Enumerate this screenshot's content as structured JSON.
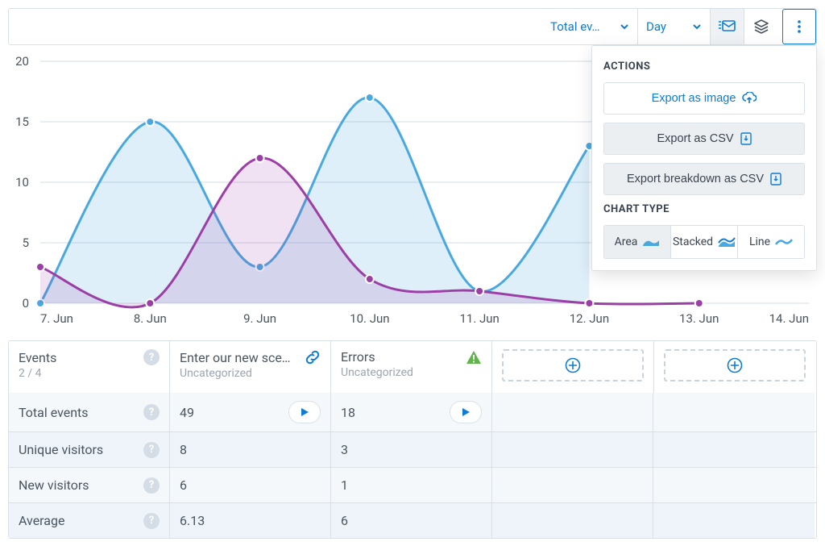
{
  "toolbar": {
    "metric_label": "Total ev…",
    "granularity_label": "Day"
  },
  "chart_data": {
    "type": "area",
    "categories": [
      "7. Jun",
      "8. Jun",
      "9. Jun",
      "10. Jun",
      "11. Jun",
      "12. Jun",
      "13. Jun",
      "14. Jun"
    ],
    "series": [
      {
        "name": "Enter our new scenario",
        "color": "#4aa8e0",
        "values": [
          0,
          15,
          3,
          17,
          1,
          13,
          null,
          null
        ]
      },
      {
        "name": "Errors",
        "color": "#9b3fa6",
        "values": [
          3,
          0,
          12,
          2,
          1,
          0,
          0,
          null
        ]
      }
    ],
    "ylim": [
      0,
      20
    ],
    "yticks": [
      0,
      5,
      10,
      15,
      20
    ],
    "xlabel": "",
    "ylabel": "",
    "title": ""
  },
  "actions_panel": {
    "heading": "ACTIONS",
    "export_image": "Export as image",
    "export_csv": "Export as CSV",
    "export_breakdown": "Export breakdown as CSV",
    "chart_type_heading": "CHART TYPE",
    "types": {
      "area": "Area",
      "stacked": "Stacked",
      "line": "Line"
    },
    "active_type": "area"
  },
  "table": {
    "header": {
      "events": {
        "title": "Events",
        "counter": "2 / 4"
      },
      "col1": {
        "title": "Enter our new sce…",
        "subtitle": "Uncategorized"
      },
      "col2": {
        "title": "Errors",
        "subtitle": "Uncategorized"
      }
    },
    "rows": [
      {
        "label": "Total events",
        "values": [
          "49",
          "18"
        ],
        "playable": true
      },
      {
        "label": "Unique visitors",
        "values": [
          "8",
          "3"
        ],
        "playable": false
      },
      {
        "label": "New visitors",
        "values": [
          "6",
          "1"
        ],
        "playable": false
      },
      {
        "label": "Average",
        "values": [
          "6.13",
          "6"
        ],
        "playable": false
      }
    ]
  },
  "colors": {
    "primary": "#0e7cd1",
    "success": "#5fb648"
  }
}
